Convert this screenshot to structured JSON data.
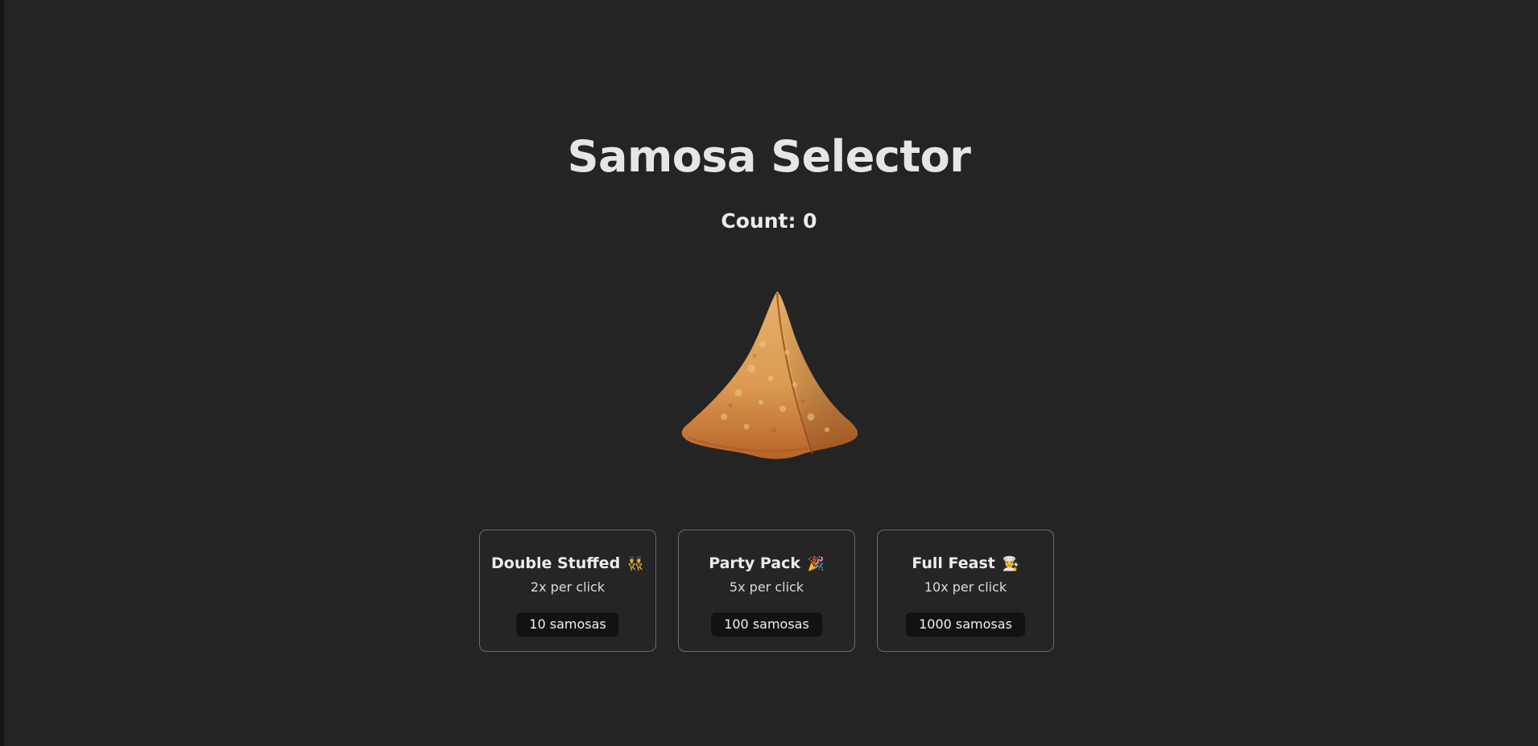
{
  "title": "Samosa Selector",
  "count": "Count: 0",
  "samosa": {
    "alt": "samosa"
  },
  "upgrades": [
    {
      "name": "Double Stuffed",
      "emoji": "👯",
      "description": "2x per click",
      "cost": "10 samosas"
    },
    {
      "name": "Party Pack",
      "emoji": "🎉",
      "description": "5x per click",
      "cost": "100 samosas"
    },
    {
      "name": "Full Feast",
      "emoji": "👩‍🍳",
      "description": "10x per click",
      "cost": "1000 samosas"
    }
  ],
  "colors": {
    "background": "#242424",
    "card_border": "#6a6a6a",
    "cost_badge": "#121212",
    "samosa": "#d9944a"
  }
}
